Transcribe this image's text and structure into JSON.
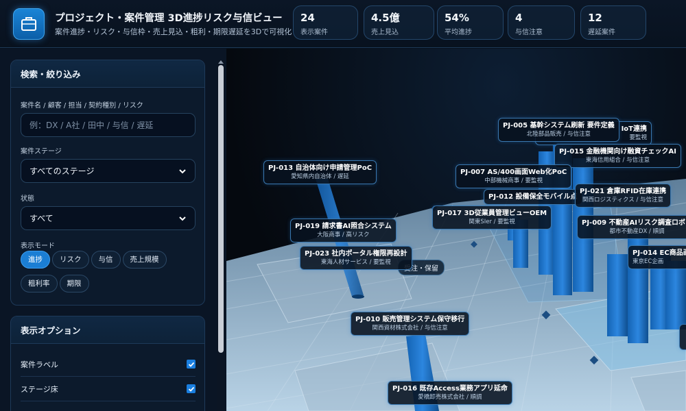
{
  "header": {
    "title": "プロジェクト・案件管理 3D進捗リスク与信ビュー",
    "subtitle": "案件進捗・リスク・与信枠・売上見込・粗利・期限遅延を3Dで可視化",
    "stats": [
      {
        "value": "24",
        "label": "表示案件"
      },
      {
        "value": "4.5億",
        "label": "売上見込"
      },
      {
        "value": "54%",
        "label": "平均進捗"
      },
      {
        "value": "4",
        "label": "与信注意"
      },
      {
        "value": "12",
        "label": "遅延案件"
      }
    ]
  },
  "filter_panel": {
    "title": "検索・絞り込み",
    "search_label": "案件名 / 顧客 / 担当 / 契約種別 / リスク",
    "search_placeholder": "例：DX / A社 / 田中 / 与信 / 遅延",
    "stage_label": "案件ステージ",
    "stage_value": "すべてのステージ",
    "status_label": "状態",
    "status_value": "すべて",
    "mode_label": "表示モード",
    "modes": [
      "進捗",
      "リスク",
      "与信",
      "売上規模",
      "粗利率",
      "期限"
    ],
    "active_mode": "進捗"
  },
  "options_panel": {
    "title": "表示オプション",
    "options": [
      {
        "label": "案件ラベル",
        "checked": true
      },
      {
        "label": "ステージ床",
        "checked": true
      }
    ]
  },
  "scene": {
    "stage_labels": [
      "受注・保留"
    ],
    "projects": [
      {
        "title": "PJ-013 自治体向け申請管理PoC",
        "sub": "愛知県内自治体 / 遅延"
      },
      {
        "title": "PJ-005 基幹システム刷新 要件定義",
        "sub": "北陸部品販売 / 与信注意"
      },
      {
        "title": "PJ-015 金融機関向け融資チェックAI",
        "sub": "東海信用組合 / 与信注意"
      },
      {
        "title": "PJ-007 AS/400画面Web化PoC",
        "sub": "中部機械商事 / 要監視"
      },
      {
        "title": "PJ-012 設備保全モバイル点",
        "sub": ""
      },
      {
        "title": "PJ-021 倉庫RFID在庫連携",
        "sub": "関西ロジスティクス / 与信注意"
      },
      {
        "title": "PJ-017 3D従業員管理ビューOEM",
        "sub": "関東SIer / 要監視"
      },
      {
        "title": "PJ-009 不動産AIリスク調査ロボッ",
        "sub": "都市不動産DX / 順調"
      },
      {
        "title": "PJ-019 請求書AI照合システム",
        "sub": "大阪商事 / 高リスク"
      },
      {
        "title": "PJ-023 社内ポータル権限再設計",
        "sub": "東海人材サービス / 要監視"
      },
      {
        "title": "PJ-014 EC商品画",
        "sub": "東京EC企画"
      },
      {
        "title": "PJ-010 販売管理システム保守移行",
        "sub": "関西資材株式会社 / 与信注意"
      },
      {
        "title": "PJ-016 既存Access業務アプリ延命",
        "sub": "愛橋卸売株式会社 / 順調"
      }
    ]
  },
  "colors": {
    "accent": "#1b7ed4",
    "bar": "#1a6fc4",
    "background": "#07101d"
  }
}
